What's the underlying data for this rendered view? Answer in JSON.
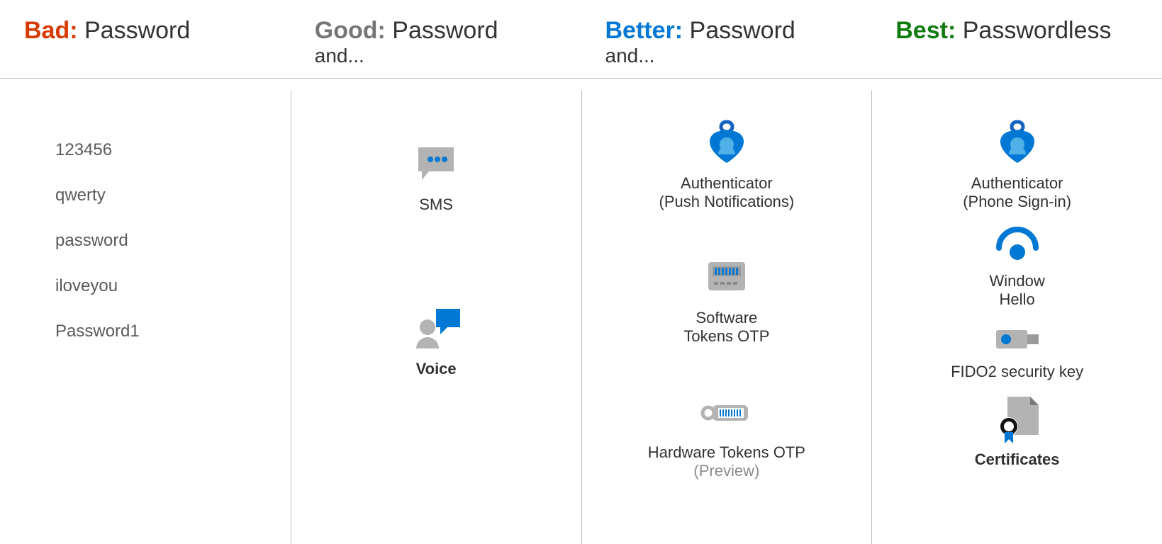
{
  "columns": [
    {
      "prefix": "Bad:",
      "suffix": " Password",
      "subheading": "",
      "bad_passwords": [
        "123456",
        "qwerty",
        "password",
        "iloveyou",
        "Password1"
      ]
    },
    {
      "prefix": "Good:",
      "suffix": " Password",
      "subheading": "and...",
      "items": [
        {
          "id": "sms",
          "label": "SMS"
        },
        {
          "id": "voice",
          "label": "Voice"
        }
      ]
    },
    {
      "prefix": "Better:",
      "suffix": " Password",
      "subheading": "and...",
      "items": [
        {
          "id": "auth-push",
          "label": "Authenticator",
          "sub": "(Push Notifications)"
        },
        {
          "id": "soft-otp",
          "label": "Software",
          "sub": "Tokens OTP"
        },
        {
          "id": "hard-otp",
          "label": "Hardware Tokens OTP",
          "sub": "(Preview)",
          "subMuted": true
        }
      ]
    },
    {
      "prefix": "Best:",
      "suffix": " Passwordless",
      "subheading": "",
      "items": [
        {
          "id": "auth-phone",
          "label": "Authenticator",
          "sub": "(Phone Sign-in)"
        },
        {
          "id": "hello",
          "label": "Window",
          "sub": "Hello"
        },
        {
          "id": "fido2",
          "label": "FIDO2 security key"
        },
        {
          "id": "certs",
          "label": "Certificates",
          "bold": true
        }
      ]
    }
  ]
}
